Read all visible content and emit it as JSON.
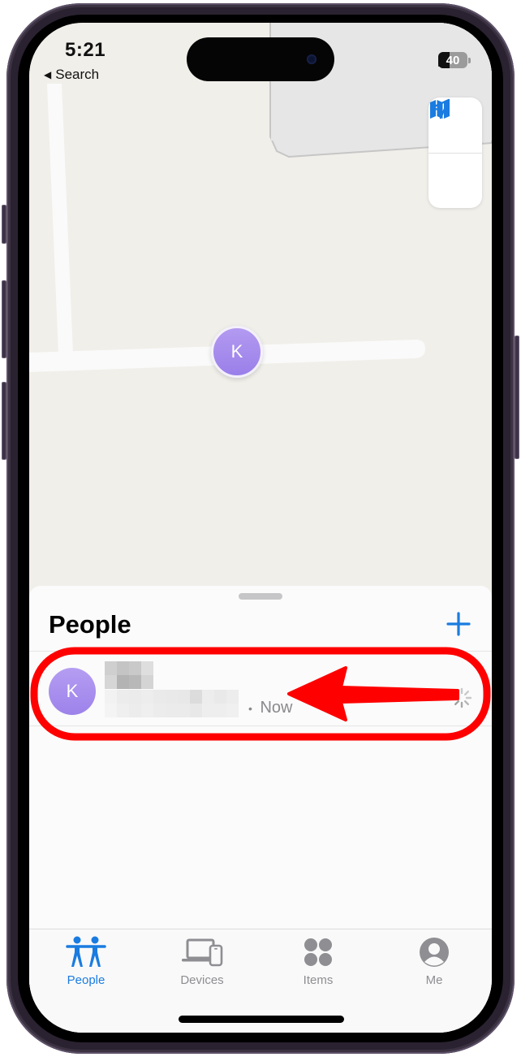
{
  "status_bar": {
    "time": "5:21",
    "back_label": "Search",
    "battery_level": "40",
    "battery_percent": 40,
    "icons": [
      "location-arrow-icon",
      "cellular-signal-icon",
      "wifi-icon",
      "battery-icon"
    ]
  },
  "map": {
    "pin_initial": "K",
    "controls": [
      {
        "name": "map-mode",
        "icon": "map-icon"
      },
      {
        "name": "current-location",
        "icon": "location-arrow-outline-icon"
      }
    ]
  },
  "sheet": {
    "title": "People",
    "add_icon": "plus-icon",
    "people": [
      {
        "initial": "K",
        "name": "[redacted]",
        "location": "[redacted]",
        "separator": "•",
        "time": "Now",
        "status_icon": "loading-spinner-icon"
      }
    ]
  },
  "tab_bar": {
    "tabs": [
      {
        "label": "People",
        "icon": "people-icon",
        "active": true
      },
      {
        "label": "Devices",
        "icon": "devices-icon",
        "active": false
      },
      {
        "label": "Items",
        "icon": "items-icon",
        "active": false
      },
      {
        "label": "Me",
        "icon": "person-circle-icon",
        "active": false
      }
    ]
  },
  "colors": {
    "accent": "#1a7ce0",
    "avatar": "#a58cee",
    "annotation": "#ff0000",
    "map_bg": "#f1efea",
    "inactive_tab": "#8e8e93"
  }
}
